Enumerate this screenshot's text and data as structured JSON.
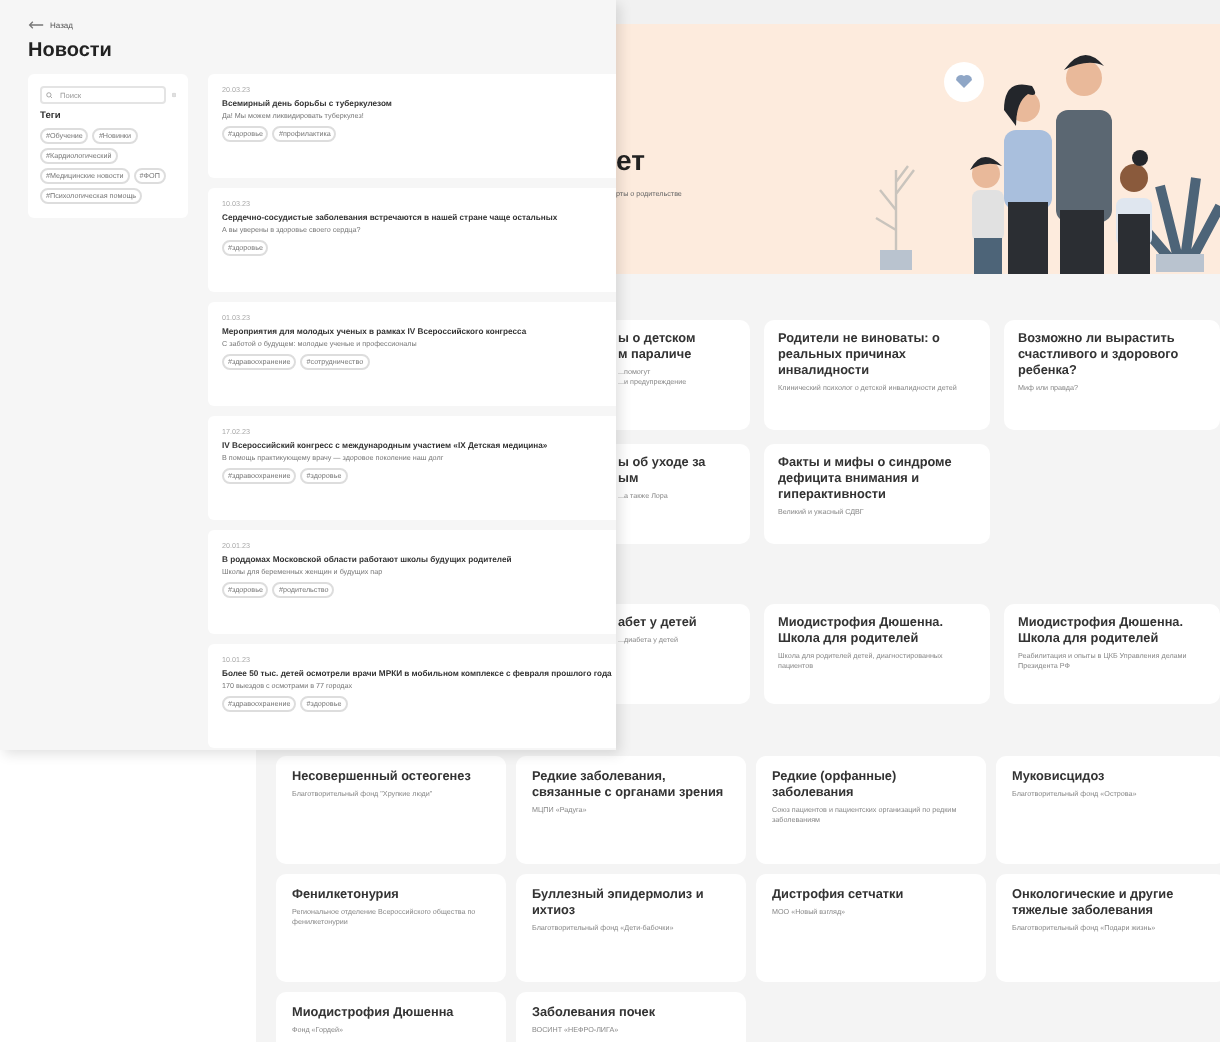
{
  "news_page": {
    "back_link": "Назад",
    "title": "Новости",
    "search": {
      "placeholder": "Поиск"
    },
    "tags_title": "Теги",
    "tags": [
      "#Обучение",
      "#Новинки",
      "#Кардиологический",
      "#Медицинские новости",
      "#ФОП",
      "#Психологическая помощь"
    ],
    "articles": [
      {
        "date": "20.03.23",
        "title": "Всемирный день борьбы с туберкулезом",
        "summary": "Да! Мы можем ликвидировать туберкулез!",
        "tags": [
          "#здоровье",
          "#профилактика"
        ]
      },
      {
        "date": "10.03.23",
        "title": "Сердечно-сосудистые заболевания встречаются в нашей стране чаще остальных",
        "summary": "А вы уверены в здоровье своего сердца?",
        "tags": [
          "#здоровье"
        ]
      },
      {
        "date": "01.03.23",
        "title": "Мероприятия для молодых ученых в рамках IV Всероссийского конгресса",
        "summary": "С заботой о будущем: молодые ученые и профессионалы",
        "tags": [
          "#здравоохранение",
          "#сотрудничество"
        ]
      },
      {
        "date": "17.02.23",
        "title": "IV Всероссийский конгресс с международным участием «IX Детская медицина»",
        "summary": "В помощь практикующему врачу — здоровое поколение наш долг",
        "tags": [
          "#здравоохранение",
          "#здоровье"
        ]
      },
      {
        "date": "20.01.23",
        "title": "В роддомах Московской области работают школы будущих родителей",
        "summary": "Школы для беременных женщин и будущих пар",
        "tags": [
          "#здоровье",
          "#родительство"
        ]
      },
      {
        "date": "10.01.23",
        "title": "Более 50 тыс. детей осмотрели врачи МРКИ в мобильном комплексе с февраля прошлого года",
        "summary": "170 выездов с осмотрами в 77 городах",
        "tags": [
          "#здравоохранение",
          "#здоровье"
        ]
      }
    ]
  },
  "topics_page": {
    "hero": {
      "title": "ет",
      "subtitle": "рты о родительстве"
    },
    "article_rows": [
      [
        {
          "title": "ы о детском\nм параличе",
          "subtitle": "...помогут\n...и предупреждение"
        },
        {
          "title": "Родители не виноваты: о реальных причинах инвалидности",
          "subtitle": "Клинический психолог о детской инвалидности детей"
        },
        {
          "title": "Возможно ли вырастить счастливого и здорового ребенка?",
          "subtitle": "Миф или правда?"
        }
      ],
      [
        {
          "title": "ы об уходе за\nым",
          "subtitle": "...а также Лора"
        },
        {
          "title": "Факты и мифы о синдроме дефицита внимания и гиперактивности",
          "subtitle": "Великий и ужасный СДВГ"
        }
      ],
      [
        {
          "title": "абет у детей",
          "subtitle": "...диабета у детей"
        },
        {
          "title": "Миодистрофия Дюшенна. Школа для родителей",
          "subtitle": "Школа для родителей детей, диагностированных пациентов"
        },
        {
          "title": "Миодистрофия Дюшенна. Школа для родителей",
          "subtitle": "Реабилитация и опыты в ЦКБ Управления делами Президента РФ"
        }
      ]
    ],
    "disease_cards": [
      {
        "title": "Несовершенный остеогенез",
        "subtitle": "Благотворительный фонд \"Хрупкие люди\""
      },
      {
        "title": "Редкие заболевания, связанные с органами зрения",
        "subtitle": "МЦПИ «Радуга»"
      },
      {
        "title": "Редкие (орфанные) заболевания",
        "subtitle": "Союз пациентов и пациентских организаций по редким заболеваниям"
      },
      {
        "title": "Муковисцидоз",
        "subtitle": "Благотворительный фонд «Острова»"
      },
      {
        "title": "Фенилкетонурия",
        "subtitle": "Региональное отделение Всероссийского общества по фенилкетонурии"
      },
      {
        "title": "Буллезный эпидермолиз и ихтиоз",
        "subtitle": "Благотворительный фонд «Дети-бабочки»"
      },
      {
        "title": "Дистрофия сетчатки",
        "subtitle": "МОО «Новый взгляд»"
      },
      {
        "title": "Онкологические и другие тяжелые заболевания",
        "subtitle": "Благотворительный фонд «Подари жизнь»"
      },
      {
        "title": "Миодистрофия Дюшенна",
        "subtitle": "Фонд «Гордей»"
      },
      {
        "title": "Заболевания почек",
        "subtitle": "ВОСИНТ «НЕФРО-ЛИГА»"
      }
    ]
  }
}
